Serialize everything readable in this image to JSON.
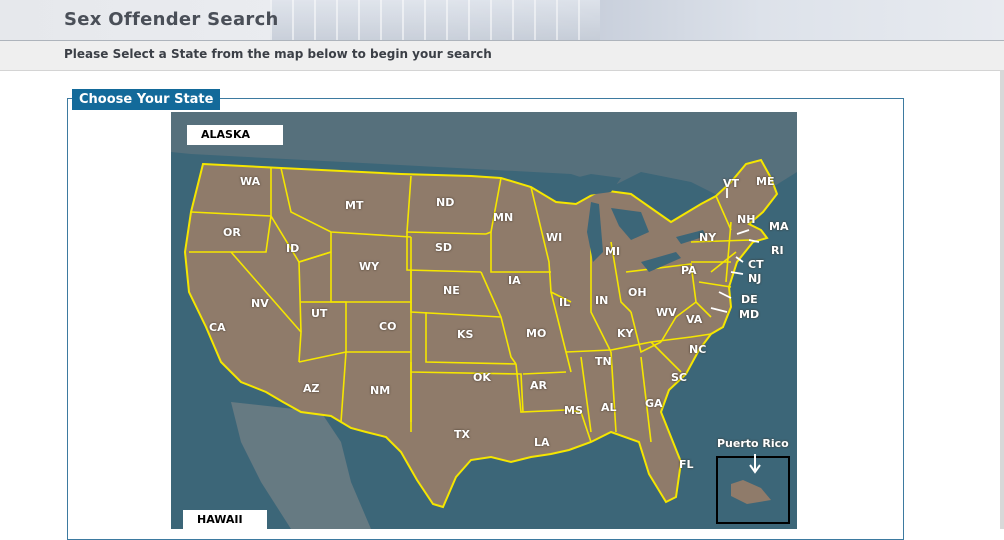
{
  "header": {
    "title": "Sex Offender Search"
  },
  "subheader": {
    "instruction": "Please Select a State from the map below to begin your search"
  },
  "section": {
    "legend": "Choose Your State"
  },
  "map": {
    "alaska_label": "ALASKA",
    "hawaii_label": "HAWAII",
    "puerto_rico_label": "Puerto Rico",
    "states": [
      "WA",
      "OR",
      "CA",
      "ID",
      "NV",
      "MT",
      "WY",
      "UT",
      "AZ",
      "CO",
      "NM",
      "ND",
      "SD",
      "NE",
      "KS",
      "OK",
      "TX",
      "MN",
      "IA",
      "MO",
      "AR",
      "LA",
      "WI",
      "IL",
      "MS",
      "MI",
      "IN",
      "KY",
      "TN",
      "AL",
      "OH",
      "GA",
      "FL",
      "WV",
      "VA",
      "NC",
      "SC",
      "PA",
      "NY",
      "VT",
      "ME",
      "NH",
      "MA",
      "RI",
      "CT",
      "NJ",
      "DE",
      "MD"
    ],
    "colors": {
      "land": "#8f7b6a",
      "water": "#3c6678",
      "border": "#f5e600"
    }
  }
}
